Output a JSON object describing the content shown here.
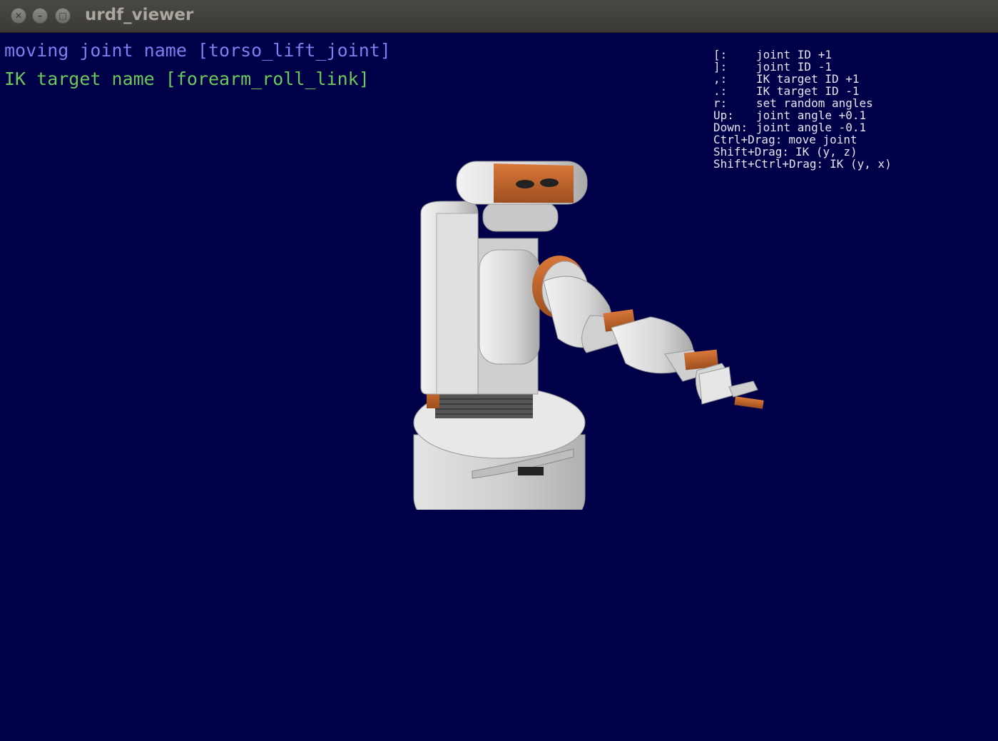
{
  "window": {
    "title": "urdf_viewer",
    "controls": {
      "close_icon": "close-icon",
      "minimize_icon": "minimize-icon",
      "maximize_icon": "maximize-icon"
    }
  },
  "hud": {
    "moving_joint": "moving joint name [torso_lift_joint]",
    "ik_target": "IK target name [forearm_roll_link]"
  },
  "help": [
    {
      "key": "[:",
      "desc": "joint ID +1"
    },
    {
      "key": "]:",
      "desc": "joint ID -1"
    },
    {
      "key": ",:",
      "desc": "IK target ID +1"
    },
    {
      "key": ".:",
      "desc": "IK target ID -1"
    },
    {
      "key": "r:",
      "desc": "set random angles"
    },
    {
      "key": "Up:",
      "desc": "joint angle +0.1"
    },
    {
      "key": "Down:",
      "desc": "joint angle -0.1"
    },
    {
      "key": "Ctrl+Drag:",
      "desc": "move joint"
    },
    {
      "key": "Shift+Drag:",
      "desc": "IK (y, z)"
    },
    {
      "key": "Shift+Ctrl+Drag:",
      "desc": "IK (y, x)"
    }
  ],
  "colors": {
    "background": "#000048",
    "joint_text": "#7e7ef0",
    "ik_text": "#6cc85a",
    "help_text": "#e6e6f0",
    "robot_body": "#d2d2d2",
    "robot_accent": "#c0622a"
  }
}
